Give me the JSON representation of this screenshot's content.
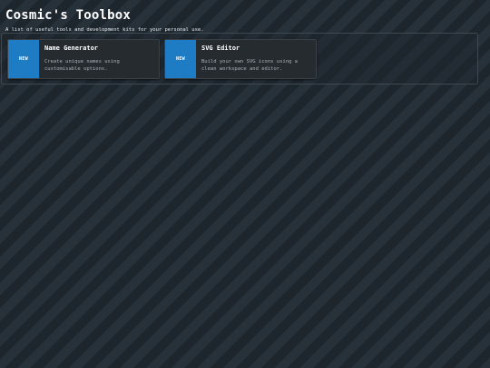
{
  "header": {
    "title": "Cosmic's Toolbox",
    "subtitle": "A list of useful tools and development kits for your personal use."
  },
  "tools": [
    {
      "badge": "NEW",
      "title": "Name Generator",
      "description": "Create unique names using customisable options."
    },
    {
      "badge": "NEW",
      "title": "SVG Editor",
      "description": "Build your own SVG icons using a clean workspace and editor."
    }
  ],
  "colors": {
    "accent": "#1d7cc4",
    "card_background": "#262b30",
    "page_background": "#222b33"
  }
}
